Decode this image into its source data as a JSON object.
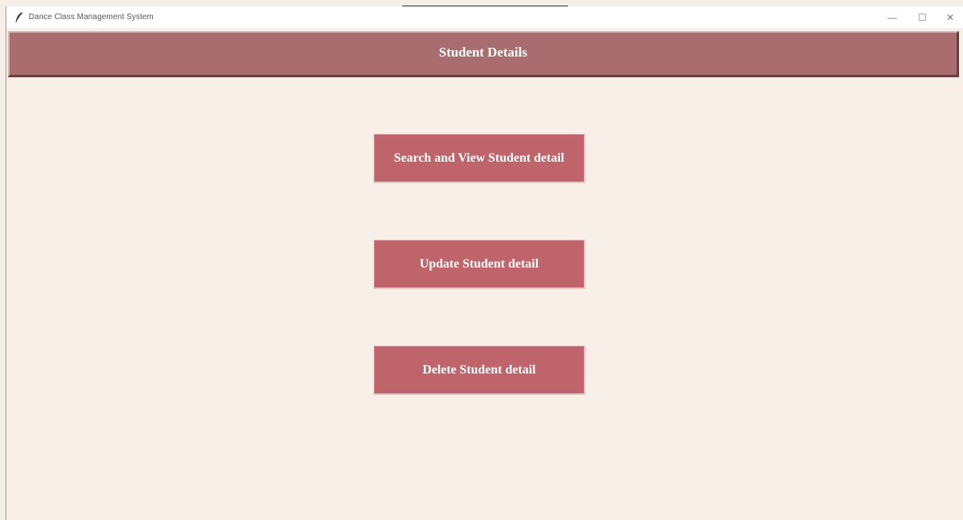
{
  "window": {
    "title": "Dance Class Management System",
    "controls": {
      "minimize": "—",
      "maximize": "☐",
      "close": "✕"
    }
  },
  "header": {
    "title": "Student Details"
  },
  "actions": [
    {
      "label": "Search and View Student detail"
    },
    {
      "label": "Update Student detail"
    },
    {
      "label": "Delete Student detail"
    }
  ],
  "colors": {
    "background": "#f7efe8",
    "header_bg": "#a96d6f",
    "button_bg": "#bf646b",
    "text_light": "#ffffff"
  }
}
